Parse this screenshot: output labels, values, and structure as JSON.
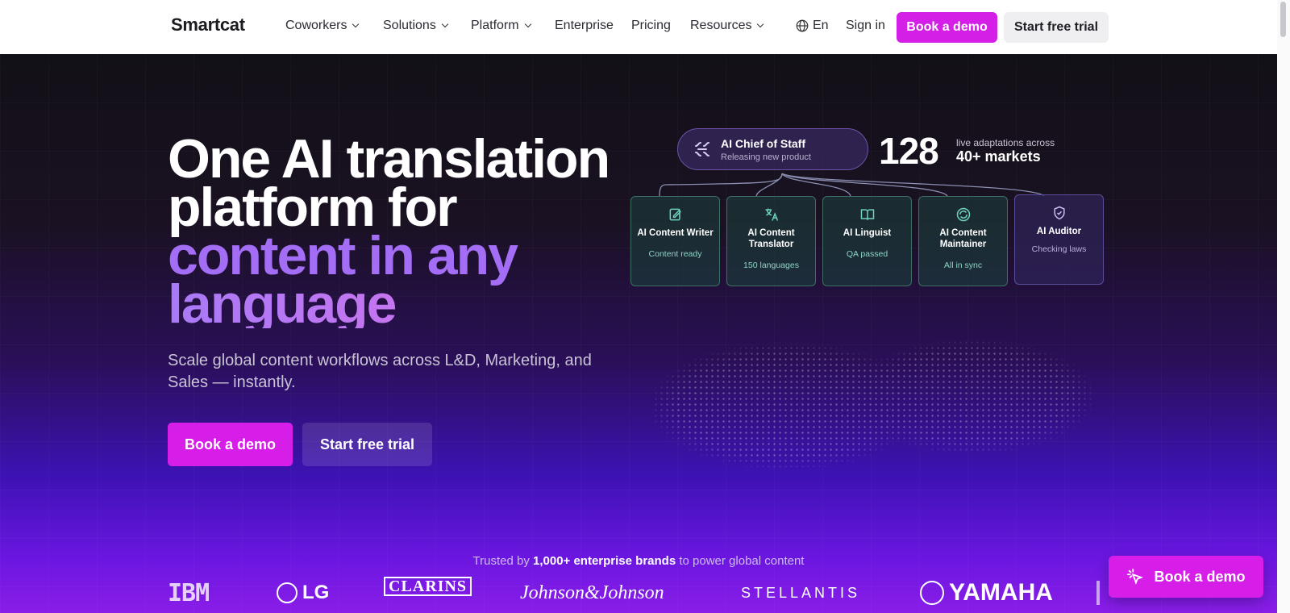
{
  "nav": {
    "logo": "Smartcat",
    "items": [
      {
        "label": "Coworkers",
        "has_dropdown": true
      },
      {
        "label": "Solutions",
        "has_dropdown": true
      },
      {
        "label": "Platform",
        "has_dropdown": true
      },
      {
        "label": "Enterprise",
        "has_dropdown": false
      },
      {
        "label": "Pricing",
        "has_dropdown": false
      },
      {
        "label": "Resources",
        "has_dropdown": true
      }
    ],
    "language": "En",
    "language_icon": "globe-icon",
    "sign_in": "Sign in",
    "book_demo": "Book a demo",
    "start_trial": "Start free trial"
  },
  "hero": {
    "headline": {
      "line1": "One AI translation",
      "line2": "platform for",
      "line3": "content in any",
      "line4": "language"
    },
    "subtext": "Scale global content workflows across L&D, Marketing, and Sales — instantly.",
    "book_demo": "Book a demo",
    "start_trial": "Start free trial"
  },
  "diagram": {
    "chief": {
      "title": "AI Chief of Staff",
      "subtitle": "Releasing new product",
      "icon": "sparkle-icon"
    },
    "stat": {
      "number": "128",
      "label_top": "live adaptations across",
      "label_bottom": "40+ markets"
    },
    "agents": [
      {
        "title": "AI Content Writer",
        "subtitle": "Content ready",
        "icon": "edit-icon"
      },
      {
        "title": "AI Content Translator",
        "subtitle": "150 languages",
        "icon": "translate-icon"
      },
      {
        "title": "AI Linguist",
        "subtitle": "QA passed",
        "icon": "book-icon"
      },
      {
        "title": "AI Content Maintainer",
        "subtitle": "All in sync",
        "icon": "sync-icon"
      },
      {
        "title": "AI Auditor",
        "subtitle": "Checking laws",
        "icon": "shield-check-icon"
      }
    ]
  },
  "trusted": {
    "prefix": "Trusted by",
    "highlight": "1,000+ enterprise brands",
    "suffix": "to power global content"
  },
  "logos": [
    "IBM",
    "LG",
    "CLARINS",
    "Johnson&Johnson",
    "STELLANTIS",
    "YAMAHA"
  ],
  "floating_cta": {
    "label": "Book a demo",
    "icon": "cursor-click-icon"
  },
  "colors": {
    "accent": "#d61ee8",
    "purple_text": "#a46df5",
    "teal_card": "#1b3c3a",
    "dark_bg": "#121017"
  }
}
